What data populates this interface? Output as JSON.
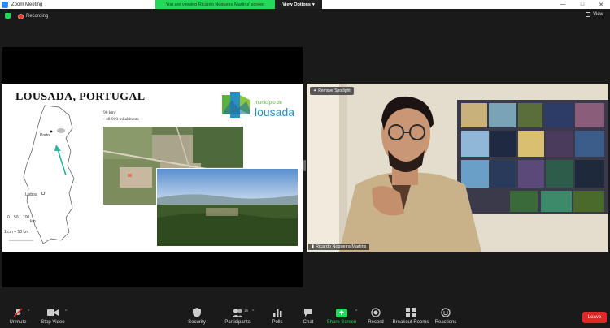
{
  "window": {
    "title": "Zoom Meeting",
    "controls": [
      "—",
      "□",
      "✕"
    ]
  },
  "share_banner": {
    "viewing_text": "You are viewing Ricardo Nogueira Martins' screen",
    "view_options_label": "View Options",
    "view_options_caret": "▾"
  },
  "status": {
    "recording_label": "Recording",
    "view_label": "View"
  },
  "slide": {
    "title": "LOUSADA, PORTUGAL",
    "stats_area": "96 km²",
    "stats_population": "~48 000 inhabitants",
    "logo_top": "município de",
    "logo_name": "lousada",
    "map_labels": {
      "porto": "Porto",
      "lisboa": "Lisboa",
      "scale_0": "0",
      "scale_50": "50",
      "scale_100": "100",
      "scale_unit": "km",
      "scale_ratio": "1 cm = 50 km"
    }
  },
  "video": {
    "spotlight_label": "Remove Spotlight",
    "participant_name": "Ricardo Nogueira Martins"
  },
  "toolbar": {
    "unmute": "Unmute",
    "stop_video": "Stop Video",
    "security": "Security",
    "participants": "Participants",
    "participants_count": "16",
    "polls": "Polls",
    "chat": "Chat",
    "share_screen": "Share Screen",
    "record": "Record",
    "breakout_rooms": "Breakout Rooms",
    "reactions": "Reactions",
    "leave": "Leave",
    "caret": "^"
  },
  "colors": {
    "accent_green": "#23d959",
    "leave_red": "#e02828",
    "recording_red": "#e8372c",
    "toolbar_bg": "#1a1a1a"
  }
}
